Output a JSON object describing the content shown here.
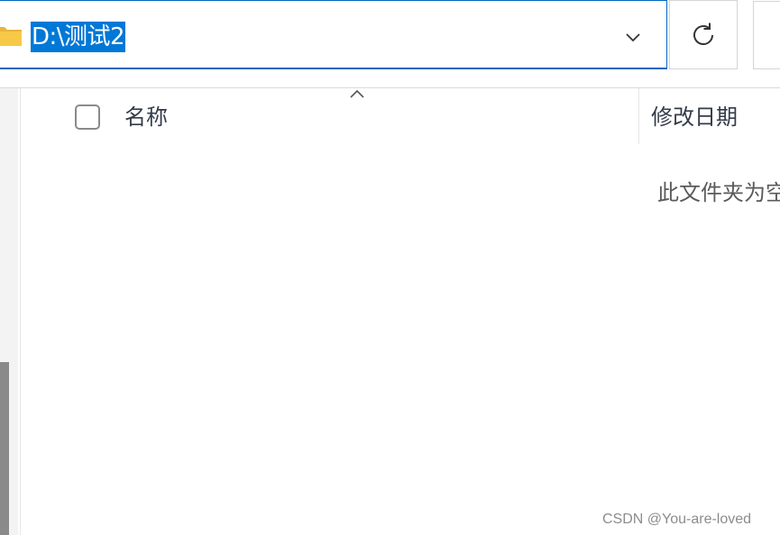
{
  "address_bar": {
    "path": "D:\\测试2",
    "folder_icon": "folder-icon",
    "dropdown_icon": "chevron-down-icon"
  },
  "toolbar": {
    "refresh_icon": "refresh-icon"
  },
  "file_list": {
    "columns": [
      {
        "label": "名称",
        "sorted": "ascending"
      },
      {
        "label": "修改日期"
      }
    ],
    "empty_message": "此文件夹为空。"
  },
  "watermark": "CSDN @You-are-loved",
  "colors": {
    "accent": "#0078d7",
    "selection_text": "#ffffff",
    "header_text": "#333b4a",
    "folder_yellow": "#f7c948"
  }
}
